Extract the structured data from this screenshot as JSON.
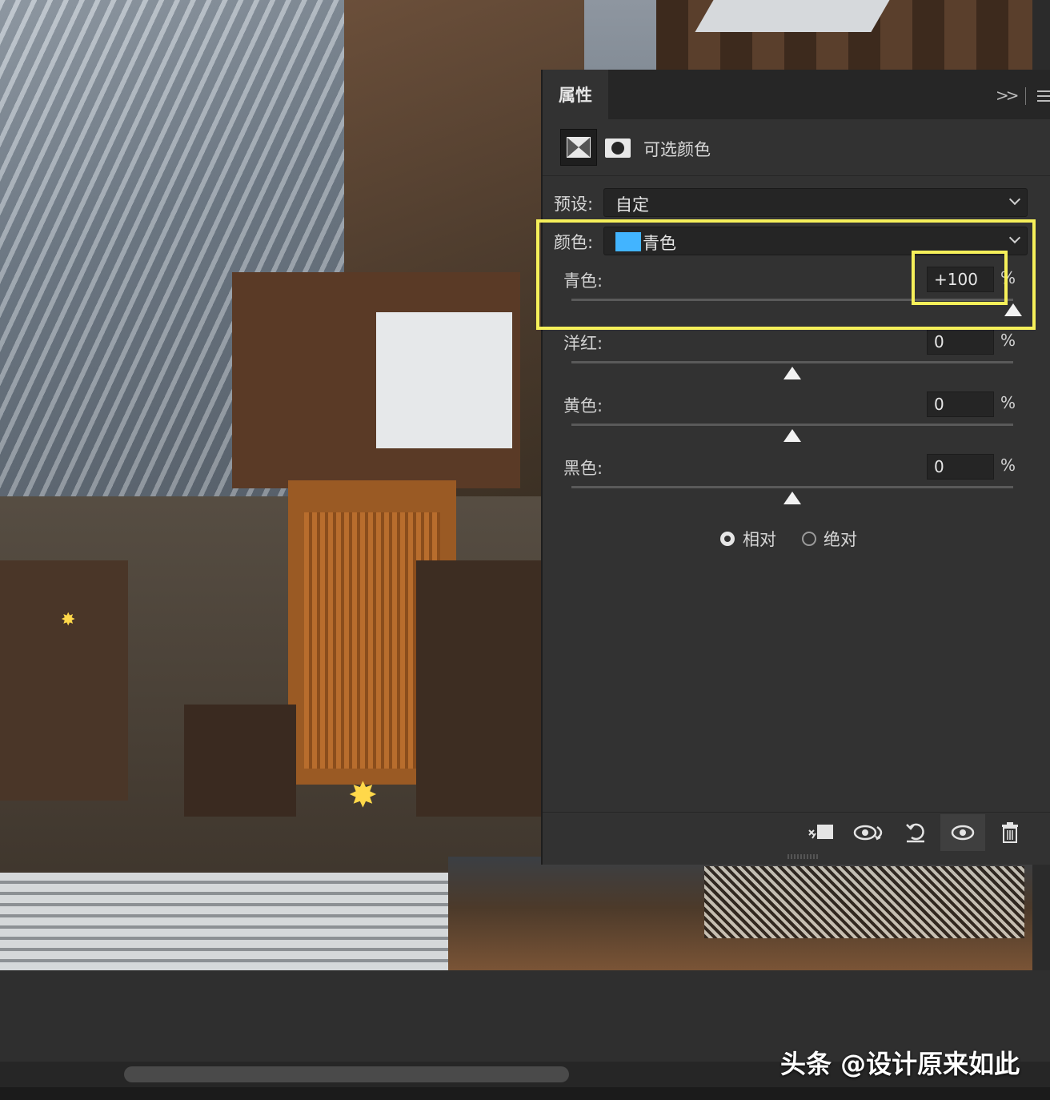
{
  "panel": {
    "tab_label": "属性",
    "adjustment_title": "可选颜色",
    "preset_label": "预设:",
    "preset_value": "自定",
    "color_label": "颜色:",
    "color_value": "青色",
    "swatch_color": "#42b4ff",
    "rows": [
      {
        "label": "青色:",
        "value": "+100",
        "unit": "%",
        "slider_fraction": 1.0
      },
      {
        "label": "洋红:",
        "value": "0",
        "unit": "%",
        "slider_fraction": 0.5
      },
      {
        "label": "黄色:",
        "value": "0",
        "unit": "%",
        "slider_fraction": 0.5
      },
      {
        "label": "黑色:",
        "value": "0",
        "unit": "%",
        "slider_fraction": 0.5
      }
    ],
    "method": {
      "relative_label": "相对",
      "absolute_label": "绝对",
      "selected": "relative"
    },
    "footer_icons": [
      "clip-to-layer-icon",
      "view-previous-state-icon",
      "reset-icon",
      "visibility-eye-icon",
      "trash-icon"
    ]
  },
  "annotation_color": "#f6f05a",
  "watermark": "头条 @设计原来如此"
}
